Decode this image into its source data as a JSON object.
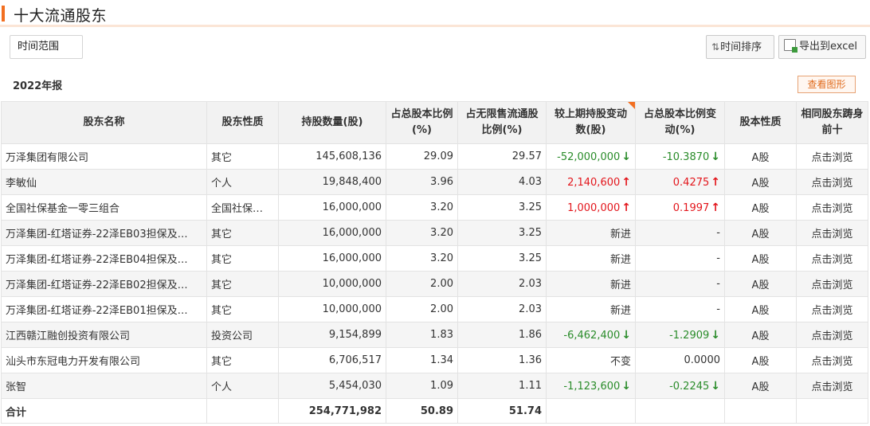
{
  "page": {
    "title": "十大流通股东"
  },
  "toolbar": {
    "time_range_label": "时间范围",
    "sort_label": "时间排序",
    "sort_icon": "sort-arrows-icon",
    "export_label": "导出到excel",
    "export_icon": "excel-icon"
  },
  "report": {
    "period": "2022年报",
    "chart_button": "查看图形"
  },
  "colors": {
    "accent": "#f26f21",
    "up": "#e3161c",
    "down": "#2a8c2a",
    "link": "#1a3ea8"
  },
  "table": {
    "headers": [
      "股东名称",
      "股东性质",
      "持股数量(股)",
      "占总股本比例(%)",
      "占无限售流通股比例(%)",
      "较上期持股变动数(股)",
      "占总股本比例变动(%)",
      "股本性质",
      "相同股东踌身前十"
    ],
    "rows": [
      {
        "name": "万泽集团有限公司",
        "nature": "其它",
        "shares": "145,608,136",
        "pct_total": "29.09",
        "pct_float": "29.57",
        "change": "-52,000,000",
        "change_dir": "down",
        "pct_change": "-10.3870",
        "pct_change_dir": "down",
        "share_type": "A股",
        "link": "点击浏览"
      },
      {
        "name": "李敏仙",
        "nature": "个人",
        "shares": "19,848,400",
        "pct_total": "3.96",
        "pct_float": "4.03",
        "change": "2,140,600",
        "change_dir": "up",
        "pct_change": "0.4275",
        "pct_change_dir": "up",
        "share_type": "A股",
        "link": "点击浏览"
      },
      {
        "name": "全国社保基金一零三组合",
        "nature": "全国社保…",
        "shares": "16,000,000",
        "pct_total": "3.20",
        "pct_float": "3.25",
        "change": "1,000,000",
        "change_dir": "up",
        "pct_change": "0.1997",
        "pct_change_dir": "up",
        "share_type": "A股",
        "link": "点击浏览"
      },
      {
        "name": "万泽集团-红塔证券-22泽EB03担保及…",
        "nature": "其它",
        "shares": "16,000,000",
        "pct_total": "3.20",
        "pct_float": "3.25",
        "change": "新进",
        "change_dir": "none",
        "pct_change": "-",
        "pct_change_dir": "none",
        "share_type": "A股",
        "link": "点击浏览"
      },
      {
        "name": "万泽集团-红塔证券-22泽EB04担保及…",
        "nature": "其它",
        "shares": "16,000,000",
        "pct_total": "3.20",
        "pct_float": "3.25",
        "change": "新进",
        "change_dir": "none",
        "pct_change": "-",
        "pct_change_dir": "none",
        "share_type": "A股",
        "link": "点击浏览"
      },
      {
        "name": "万泽集团-红塔证券-22泽EB02担保及…",
        "nature": "其它",
        "shares": "10,000,000",
        "pct_total": "2.00",
        "pct_float": "2.03",
        "change": "新进",
        "change_dir": "none",
        "pct_change": "-",
        "pct_change_dir": "none",
        "share_type": "A股",
        "link": "点击浏览"
      },
      {
        "name": "万泽集团-红塔证券-22泽EB01担保及…",
        "nature": "其它",
        "shares": "10,000,000",
        "pct_total": "2.00",
        "pct_float": "2.03",
        "change": "新进",
        "change_dir": "none",
        "pct_change": "-",
        "pct_change_dir": "none",
        "share_type": "A股",
        "link": "点击浏览"
      },
      {
        "name": "江西赣江融创投资有限公司",
        "nature": "投资公司",
        "shares": "9,154,899",
        "pct_total": "1.83",
        "pct_float": "1.86",
        "change": "-6,462,400",
        "change_dir": "down",
        "pct_change": "-1.2909",
        "pct_change_dir": "down",
        "share_type": "A股",
        "link": "点击浏览"
      },
      {
        "name": "汕头市东冠电力开发有限公司",
        "nature": "其它",
        "shares": "6,706,517",
        "pct_total": "1.34",
        "pct_float": "1.36",
        "change": "不变",
        "change_dir": "none",
        "pct_change": "0.0000",
        "pct_change_dir": "none",
        "share_type": "A股",
        "link": "点击浏览"
      },
      {
        "name": "张智",
        "nature": "个人",
        "shares": "5,454,030",
        "pct_total": "1.09",
        "pct_float": "1.11",
        "change": "-1,123,600",
        "change_dir": "down",
        "pct_change": "-0.2245",
        "pct_change_dir": "down",
        "share_type": "A股",
        "link": "点击浏览"
      }
    ],
    "total": {
      "label": "合计",
      "shares": "254,771,982",
      "pct_total": "50.89",
      "pct_float": "51.74"
    }
  }
}
